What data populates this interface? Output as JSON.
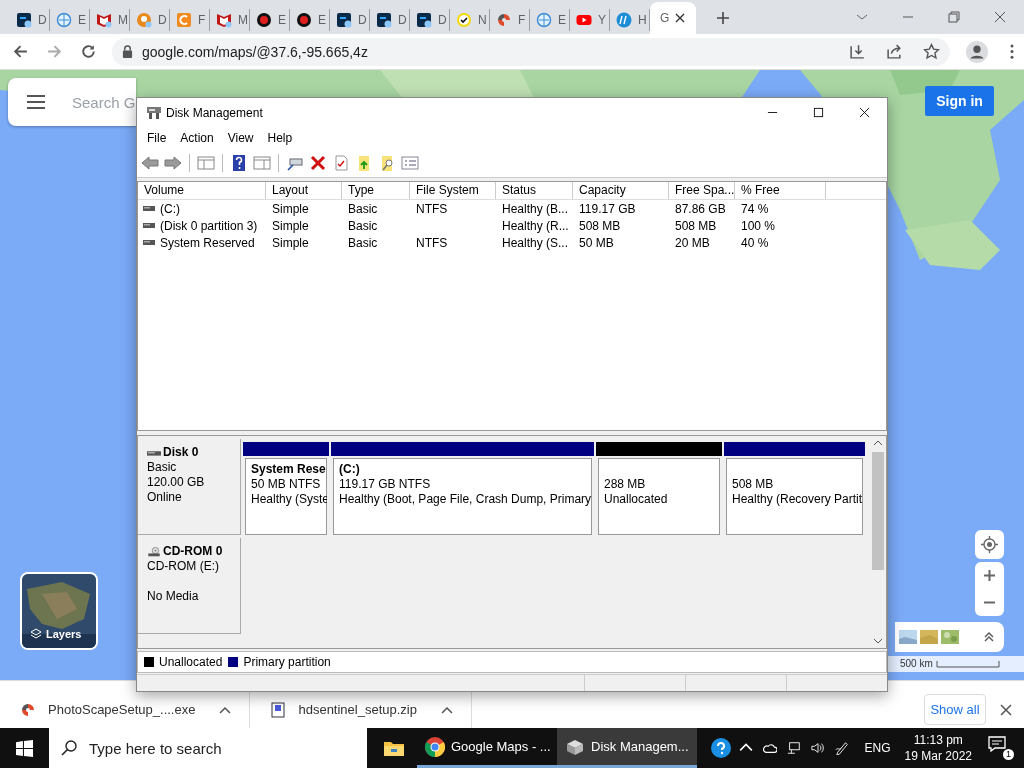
{
  "browser": {
    "tabs": [
      {
        "label": "D",
        "selected": false
      },
      {
        "label": "E",
        "selected": false
      },
      {
        "label": "M",
        "selected": false
      },
      {
        "label": "D",
        "selected": false
      },
      {
        "label": "F",
        "selected": false
      },
      {
        "label": "M",
        "selected": false
      },
      {
        "label": "E",
        "selected": false
      },
      {
        "label": "E",
        "selected": false
      },
      {
        "label": "D",
        "selected": false
      },
      {
        "label": "D",
        "selected": false
      },
      {
        "label": "D",
        "selected": false
      },
      {
        "label": "N",
        "selected": false
      },
      {
        "label": "F",
        "selected": false
      },
      {
        "label": "E",
        "selected": false
      },
      {
        "label": "Y",
        "selected": false
      },
      {
        "label": "H",
        "selected": false
      },
      {
        "label": "G",
        "selected": true
      }
    ],
    "address": "google.com/maps/@37.6,-95.665,4z"
  },
  "map": {
    "search_placeholder": "Search G",
    "sign_in": "Sign in",
    "layers": "Layers",
    "scale": "500 km"
  },
  "window": {
    "title": "Disk Management",
    "menu": [
      "File",
      "Action",
      "View",
      "Help"
    ],
    "columns": [
      "Volume",
      "Layout",
      "Type",
      "File System",
      "Status",
      "Capacity",
      "Free Spa...",
      "% Free"
    ],
    "rows": [
      [
        "(C:)",
        "Simple",
        "Basic",
        "NTFS",
        "Healthy (B...",
        "119.17 GB",
        "87.86 GB",
        "74 %"
      ],
      [
        "(Disk 0 partition 3)",
        "Simple",
        "Basic",
        "",
        "Healthy (R...",
        "508 MB",
        "508 MB",
        "100 %"
      ],
      [
        "System Reserved",
        "Simple",
        "Basic",
        "NTFS",
        "Healthy (S...",
        "50 MB",
        "20 MB",
        "40 %"
      ]
    ],
    "disks": [
      {
        "name": "Disk 0",
        "kind": "disk",
        "type": "Basic",
        "size": "120.00 GB",
        "status": "Online",
        "partitions": [
          {
            "title": "System Rese",
            "lines": [
              "50 MB NTFS",
              "Healthy (Syste"
            ],
            "color": "#000080"
          },
          {
            "title": "(C:)",
            "lines": [
              "119.17 GB NTFS",
              "Healthy (Boot, Page File, Crash Dump, Primary"
            ],
            "color": "#000080"
          },
          {
            "lines": [
              "288 MB",
              "Unallocated"
            ],
            "color": "#000000"
          },
          {
            "lines": [
              "508 MB",
              "Healthy (Recovery Partit"
            ],
            "color": "#000080"
          }
        ]
      },
      {
        "name": "CD-ROM 0",
        "kind": "cdrom",
        "type": "CD-ROM (E:)",
        "status": "No Media"
      }
    ],
    "legend": [
      {
        "label": "Unallocated",
        "color": "#000000"
      },
      {
        "label": "Primary partition",
        "color": "#000080"
      }
    ]
  },
  "downloads": {
    "items": [
      "PhotoScapeSetup_....exe",
      "hdsentinel_setup.zip"
    ],
    "show_all": "Show all"
  },
  "taskbar": {
    "search_placeholder": "Type here to search",
    "apps": [
      {
        "label": "Google Maps - ...",
        "selected": false
      },
      {
        "label": "Disk Managem...",
        "selected": true
      }
    ],
    "language": "ENG",
    "time": "11:13 pm",
    "date": "19 Mar 2022",
    "notifications": "1"
  }
}
